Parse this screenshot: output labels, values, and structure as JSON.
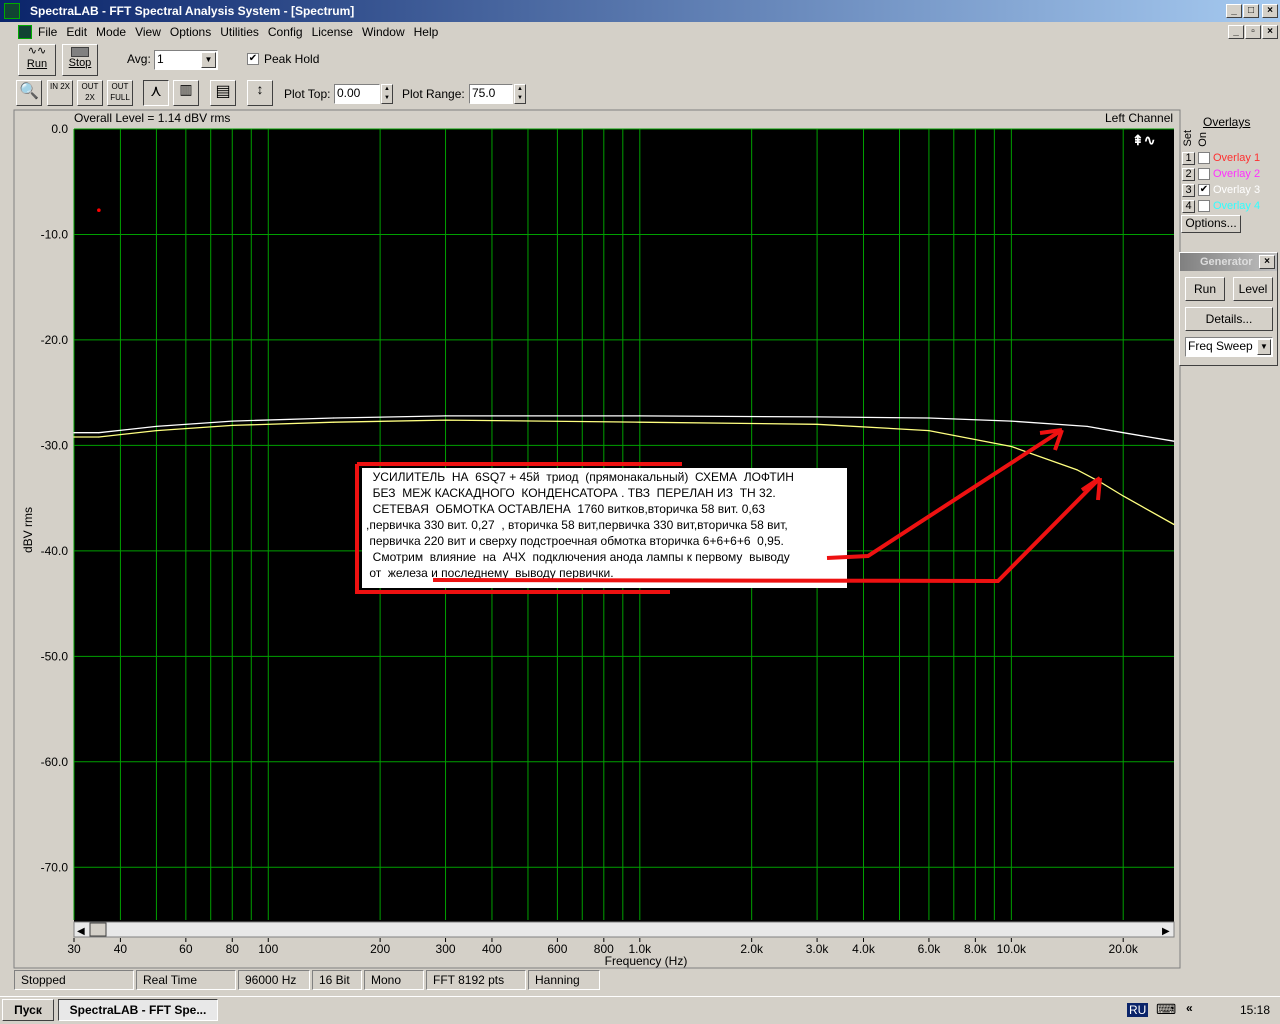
{
  "window": {
    "title": "SpectraLAB - FFT Spectral Analysis System - [Spectrum]"
  },
  "menu": [
    "File",
    "Edit",
    "Mode",
    "View",
    "Options",
    "Utilities",
    "Config",
    "License",
    "Window",
    "Help"
  ],
  "toolbar": {
    "run": "Run",
    "stop": "Stop",
    "avg_label": "Avg:",
    "avg_value": "1",
    "peak_hold": "Peak Hold",
    "peak_hold_checked": true,
    "zoom_in": "IN 2X",
    "zoom_out": "OUT 2X",
    "zoom_full": "OUT FULL",
    "plot_top_label": "Plot Top:",
    "plot_top": "0.00",
    "plot_range_label": "Plot Range:",
    "plot_range": "75.0"
  },
  "plot": {
    "overall_level": "Overall Level = 1.14 dBV rms",
    "channel": "Left Channel",
    "bg": "#000000",
    "grid_color": "#00a000"
  },
  "chart_data": {
    "type": "line",
    "xscale": "log",
    "xlim": [
      30,
      27400
    ],
    "ylim": [
      -75,
      0
    ],
    "grid": true,
    "xlabel": "Frequency (Hz)",
    "ylabel": "dBV rms",
    "xticks": [
      30,
      40,
      60,
      80,
      100,
      200,
      300,
      400,
      600,
      800,
      1000,
      2000,
      3000,
      4000,
      6000,
      8000,
      10000,
      20000
    ],
    "xtick_labels": [
      "30",
      "40",
      "60",
      "80",
      "100",
      "200",
      "300",
      "400",
      "600",
      "800",
      "1.0k",
      "2.0k",
      "3.0k",
      "4.0k",
      "6.0k",
      "8.0k",
      "10.0k",
      "20.0k"
    ],
    "yticks": [
      0,
      -10,
      -20,
      -30,
      -40,
      -50,
      -60,
      -70
    ],
    "ytick_labels": [
      "0.0",
      "-10.0",
      "-20.0",
      "-30.0",
      "-40.0",
      "-50.0",
      "-60.0",
      "-70.0"
    ],
    "series": [
      {
        "color": "#ffffff",
        "x": [
          30,
          35,
          50,
          80,
          150,
          300,
          1000,
          3000,
          6000,
          10000,
          16000,
          20000,
          27400
        ],
        "y": [
          -28.8,
          -28.8,
          -28.2,
          -27.7,
          -27.4,
          -27.2,
          -27.2,
          -27.3,
          -27.4,
          -27.7,
          -28.2,
          -28.8,
          -29.6
        ]
      },
      {
        "color": "#ffff80",
        "x": [
          30,
          35,
          50,
          80,
          150,
          300,
          1000,
          3000,
          6000,
          10000,
          15000,
          17400,
          20000,
          27400
        ],
        "y": [
          -29.2,
          -29.2,
          -28.6,
          -28.1,
          -27.8,
          -27.6,
          -27.8,
          -28.0,
          -28.6,
          -30.1,
          -32.3,
          -33.5,
          -34.8,
          -37.5
        ]
      }
    ],
    "marker": {
      "x": 35,
      "y": -7.7,
      "color": "#ff0000"
    }
  },
  "annotation": {
    "lines": [
      "  УСИЛИТЕЛЬ  НА  6SQ7 + 45й  триод  (прямонакальный)  СХЕМА  ЛОФТИН",
      "  БЕЗ  МЕЖ КАСКАДНОГО  КОНДЕНСАТОРА . ТВЗ  ПЕРЕЛАН ИЗ  ТН 32.",
      "  СЕТЕВАЯ  ОБМОТКА ОСТАВЛЕНА  1760 витков,вторичка 58 вит. 0,63",
      ",первичка 330 вит. 0,27  , вторичка 58 вит,первичка 330 вит,вторичка 58 вит,",
      " первичка 220 вит и сверху подстроечная обмотка вторичка 6+6+6+6  0,95.",
      "  Смотрим  влияние  на  АЧХ  подключения анода лампы к первому  выводу",
      " от  железа и последнему  выводу первички."
    ],
    "arrow_color": "#ff0000"
  },
  "overlays": {
    "title": "Overlays",
    "set": "Set",
    "on": "On",
    "items": [
      {
        "n": "1",
        "label": "Overlay 1",
        "color": "#ff3030",
        "on": false
      },
      {
        "n": "2",
        "label": "Overlay 2",
        "color": "#ff30ff",
        "on": false
      },
      {
        "n": "3",
        "label": "Overlay 3",
        "color": "#ffffff",
        "on": true
      },
      {
        "n": "4",
        "label": "Overlay 4",
        "color": "#30ffff",
        "on": false
      }
    ],
    "options": "Options..."
  },
  "generator": {
    "title": "Generator",
    "run": "Run",
    "level": "Level",
    "details": "Details...",
    "mode": "Freq Sweep"
  },
  "status": [
    "Stopped",
    "Real Time",
    "96000 Hz",
    "16 Bit",
    "Mono",
    "FFT 8192 pts",
    "Hanning"
  ],
  "taskbar": {
    "start": "Пуск",
    "task": "SpectraLAB - FFT Spe...",
    "lang": "RU",
    "time": "15:18"
  }
}
